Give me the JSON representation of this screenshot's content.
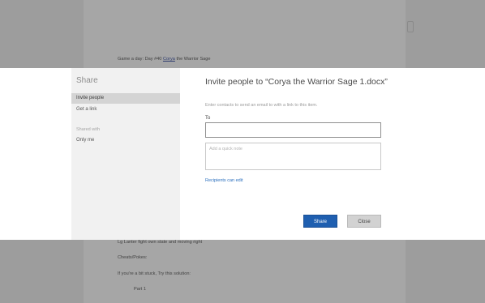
{
  "document": {
    "header_prefix": "Game a day: Day #40 ",
    "header_link": "Corya",
    "header_suffix": " the Warrior Sage",
    "lines_below": [
      "Lg Lanter fight own state and moving right",
      "Cheats/Pokes:",
      "If you're a bit stuck, Try this solution:",
      "Part 1"
    ]
  },
  "share_dialog": {
    "nav": {
      "title": "Share",
      "items": [
        "Invite people",
        "Get a link"
      ],
      "shared_with_label": "Shared with",
      "shared_with_value": "Only me"
    },
    "main": {
      "title": "Invite people to “Corya the Warrior Sage 1.docx”",
      "description": "Enter contacts to send an email to with a link to this item.",
      "to_label": "To",
      "to_value": "",
      "note_placeholder": "Add a quick note",
      "recipients_link": "Recipients can edit",
      "share_button": "Share",
      "close_button": "Close"
    }
  },
  "colors": {
    "accent": "#1f5fb0",
    "link": "#2a6fbe",
    "overlay": "#9d9d9d"
  }
}
